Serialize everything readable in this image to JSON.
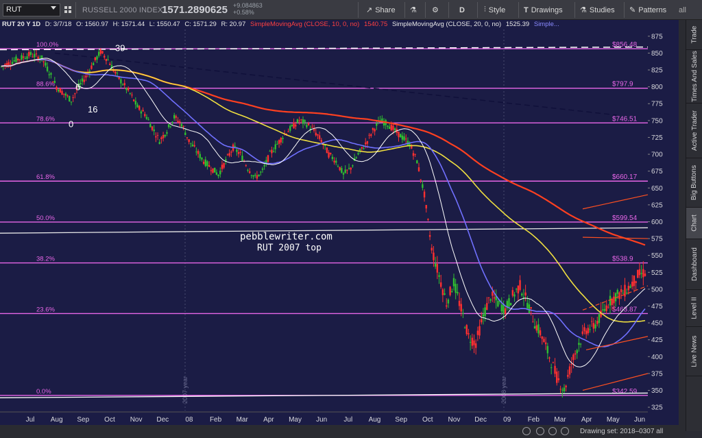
{
  "toolbar": {
    "symbol": "RUT",
    "index_name": "RUSSELL 2000 INDEX",
    "last_price": "1571.2890625",
    "net_change": "+9.084863",
    "pct_change": "+0.58%",
    "share_label": "Share",
    "period_label": "D",
    "style_label": "Style",
    "drawings_label": "Drawings",
    "studies_label": "Studies",
    "patterns_label": "Patterns",
    "all_label": "all"
  },
  "infobar": {
    "title": "RUT 20 Y 1D",
    "date": "D: 3/7/18",
    "open": "O: 1560.97",
    "high": "H: 1571.44",
    "low": "L: 1550.47",
    "close": "C: 1571.29",
    "range": "R: 20.97",
    "sma10_label": "SimpleMovingAvg (CLOSE, 10, 0, no)",
    "sma10_value": "1540.75",
    "sma20_label": "SimpleMovingAvg (CLOSE, 20, 0, no)",
    "sma20_value": "1525.39",
    "more_label": "Simple..."
  },
  "side_tabs": [
    "Trade",
    "Times And Sales",
    "Active Trader",
    "Big Buttons",
    "Chart",
    "Dashboard",
    "Level II",
    "Live News"
  ],
  "active_tab": "Chart",
  "status": {
    "drawing_set": "Drawing set: 2018–0307 all"
  },
  "colors": {
    "background": "#1b1c45",
    "fib": "#e866e8",
    "sma10": "#ffffff",
    "sma20": "#7070ff",
    "sma50": "#f0e040",
    "sma200": "#ff4020",
    "up_candle": "#30c030",
    "down_candle": "#ff3030",
    "trend_orange": "#ff5020"
  },
  "chart_data": {
    "type": "candlestick",
    "watermark": "pebblewriter.com",
    "annotation": "RUT 2007 top",
    "x_labels": [
      "Jul",
      "Aug",
      "Sep",
      "Oct",
      "Nov",
      "Dec",
      "08",
      "Feb",
      "Mar",
      "Apr",
      "May",
      "Jun",
      "Jul",
      "Aug",
      "Sep",
      "Oct",
      "Nov",
      "Dec",
      "09",
      "Feb",
      "Mar",
      "Apr",
      "May",
      "Jun"
    ],
    "year_markers": [
      "2007 year",
      "2008 year"
    ],
    "y_ticks": [
      325,
      350,
      375,
      400,
      425,
      450,
      475,
      500,
      525,
      550,
      575,
      600,
      625,
      650,
      675,
      700,
      725,
      750,
      775,
      800,
      825,
      850,
      875
    ],
    "ylim": [
      320,
      885
    ],
    "fib_levels": [
      {
        "label": "100.0%",
        "price": 856.48,
        "price_label": "$856.48"
      },
      {
        "label": "88.6%",
        "price": 797.9,
        "price_label": "$797.9"
      },
      {
        "label": "78.6%",
        "price": 746.51,
        "price_label": "$746.51"
      },
      {
        "label": "61.8%",
        "price": 660.17,
        "price_label": "$660.17"
      },
      {
        "label": "50.0%",
        "price": 599.54,
        "price_label": "$599.54"
      },
      {
        "label": "38.2%",
        "price": 538.9,
        "price_label": "$538.9"
      },
      {
        "label": "23.6%",
        "price": 463.87,
        "price_label": "$463.87"
      },
      {
        "label": "0.0%",
        "price": 342.59,
        "price_label": "$342.59"
      }
    ],
    "wave_labels": [
      "39",
      "6",
      "16",
      "0"
    ],
    "close_path": [
      [
        0,
        830
      ],
      [
        4,
        840
      ],
      [
        8,
        848
      ],
      [
        11,
        842
      ],
      [
        13,
        822
      ],
      [
        15,
        800
      ],
      [
        17,
        790
      ],
      [
        19,
        780
      ],
      [
        21,
        800
      ],
      [
        23,
        815
      ],
      [
        25,
        835
      ],
      [
        27,
        852
      ],
      [
        29,
        840
      ],
      [
        31,
        820
      ],
      [
        33,
        805
      ],
      [
        35,
        790
      ],
      [
        37,
        770
      ],
      [
        39,
        760
      ],
      [
        41,
        740
      ],
      [
        43,
        720
      ],
      [
        45,
        735
      ],
      [
        47,
        755
      ],
      [
        49,
        745
      ],
      [
        51,
        720
      ],
      [
        53,
        705
      ],
      [
        55,
        690
      ],
      [
        57,
        680
      ],
      [
        59,
        670
      ],
      [
        61,
        690
      ],
      [
        63,
        710
      ],
      [
        65,
        700
      ],
      [
        67,
        680
      ],
      [
        69,
        665
      ],
      [
        71,
        675
      ],
      [
        73,
        700
      ],
      [
        75,
        715
      ],
      [
        77,
        730
      ],
      [
        79,
        740
      ],
      [
        81,
        750
      ],
      [
        83,
        745
      ],
      [
        85,
        735
      ],
      [
        87,
        720
      ],
      [
        89,
        700
      ],
      [
        91,
        690
      ],
      [
        93,
        670
      ],
      [
        95,
        680
      ],
      [
        97,
        700
      ],
      [
        99,
        715
      ],
      [
        101,
        735
      ],
      [
        103,
        750
      ],
      [
        105,
        745
      ],
      [
        107,
        735
      ],
      [
        109,
        725
      ],
      [
        111,
        715
      ],
      [
        113,
        690
      ],
      [
        115,
        640
      ],
      [
        117,
        560
      ],
      [
        119,
        520
      ],
      [
        121,
        480
      ],
      [
        123,
        510
      ],
      [
        125,
        470
      ],
      [
        127,
        430
      ],
      [
        129,
        420
      ],
      [
        131,
        460
      ],
      [
        133,
        490
      ],
      [
        135,
        480
      ],
      [
        137,
        470
      ],
      [
        139,
        490
      ],
      [
        141,
        505
      ],
      [
        143,
        480
      ],
      [
        145,
        450
      ],
      [
        147,
        430
      ],
      [
        149,
        400
      ],
      [
        151,
        370
      ],
      [
        153,
        350
      ],
      [
        155,
        390
      ],
      [
        157,
        420
      ],
      [
        159,
        440
      ],
      [
        161,
        445
      ],
      [
        163,
        460
      ],
      [
        165,
        480
      ],
      [
        167,
        490
      ],
      [
        169,
        495
      ],
      [
        171,
        505
      ],
      [
        173,
        520
      ],
      [
        175,
        525
      ]
    ]
  }
}
